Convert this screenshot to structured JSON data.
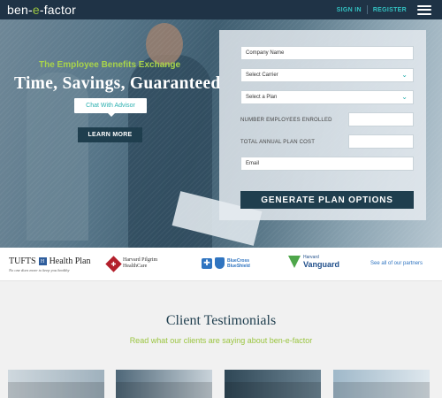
{
  "header": {
    "logo_pre": "ben",
    "logo_dash1": "-",
    "logo_mid": "e",
    "logo_dash2": "-",
    "logo_post": "factor",
    "sign_in": "SIGN IN",
    "register": "REGISTER",
    "menu_icon": "hamburger-menu-icon"
  },
  "hero": {
    "tagline": "The Employee Benefits Exchange",
    "title": "Time, Savings, Guaranteed",
    "chat_label": "Chat With Advisor",
    "learn_label": "LEARN MORE"
  },
  "form": {
    "company_name": "Company Name",
    "carrier": "Select Carrier",
    "plan": "Select a Plan",
    "employees_label": "NUMBER EMPLOYEES ENROLLED",
    "cost_label": "TOTAL ANNUAL PLAN COST",
    "email": "Email",
    "submit_label": "GENERATE PLAN OPTIONS"
  },
  "partners": {
    "tufts_name1": "TUFTS",
    "tufts_box": "H",
    "tufts_name2": "Health Plan",
    "tufts_tag": "No one does more to keep you healthy",
    "hp_line1": "Harvard Pilgrim",
    "hp_line2": "HealthCare",
    "bcbs_line1": "BlueCross",
    "bcbs_line2": "BlueShield",
    "hv_line1": "Harvard",
    "hv_line2": "Vanguard",
    "see_all": "See all of our partners"
  },
  "testimonials": {
    "title": "Client Testimonials",
    "subtitle": "Read what our clients are saying about ben-e-factor"
  },
  "colors": {
    "navy": "#1f3346",
    "teal": "#33c2c2",
    "green": "#9bc541",
    "button": "#1f3e4e"
  }
}
